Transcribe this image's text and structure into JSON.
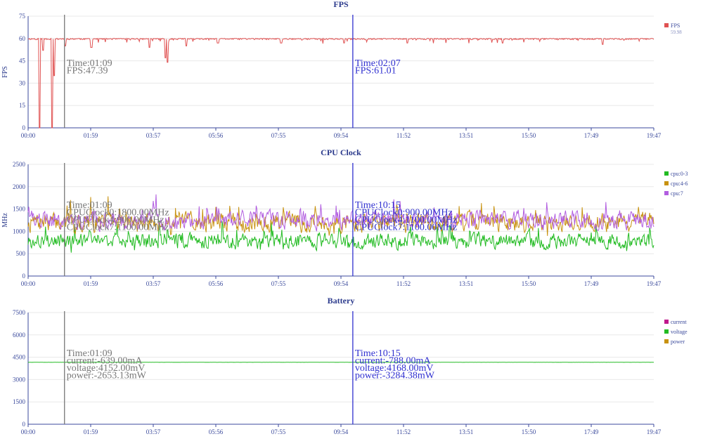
{
  "x_ticks": [
    "00:00",
    "01:59",
    "03:57",
    "05:56",
    "07:55",
    "09:54",
    "11:52",
    "13:51",
    "15:50",
    "17:49",
    "19:47"
  ],
  "x_range": [
    0,
    1187
  ],
  "charts": [
    {
      "type": "line",
      "title": "FPS",
      "ylabel": "FPS",
      "ylim": [
        0,
        75
      ],
      "yticks": [
        "0",
        "15",
        "30",
        "45",
        "60",
        "75"
      ],
      "legend": [
        {
          "name": "FPS",
          "value": "59.98",
          "color": "#e05252"
        }
      ],
      "series": [
        {
          "name": "FPS",
          "color": "#e05252",
          "baseline": 59.8,
          "noise": 1.2,
          "seed": 11,
          "dips": [
            [
              22,
              0
            ],
            [
              28,
              52
            ],
            [
              45,
              0
            ],
            [
              50,
              35
            ],
            [
              70,
              55
            ],
            [
              120,
              54
            ],
            [
              230,
              54
            ],
            [
              260,
              47
            ],
            [
              264,
              44
            ],
            [
              300,
              55
            ],
            [
              360,
              57
            ],
            [
              480,
              57
            ],
            [
              600,
              57
            ],
            [
              720,
              57
            ],
            [
              900,
              57
            ],
            [
              1090,
              56
            ]
          ]
        }
      ],
      "cursors": [
        {
          "x": 69,
          "color": "#777777",
          "lines": [
            "Time:01:09",
            "FPS:47.39"
          ]
        },
        {
          "x": 616,
          "color": "#3030d0",
          "lines": [
            "Time:02:07",
            "FPS:61.01"
          ]
        }
      ]
    },
    {
      "type": "line",
      "title": "CPU Clock",
      "ylabel": "MHz",
      "ylim": [
        0,
        2500
      ],
      "yticks": [
        "0",
        "500",
        "1000",
        "1500",
        "2000",
        "2500"
      ],
      "legend": [
        {
          "name": "cpu:0-3",
          "color": "#22bb22"
        },
        {
          "name": "cpu:4-6",
          "color": "#c89210"
        },
        {
          "name": "cpu:7",
          "color": "#b25ee0"
        }
      ],
      "series": [
        {
          "name": "cpu:0-3",
          "color": "#22bb22",
          "baseline": 780,
          "noise": 260,
          "seed": 3
        },
        {
          "name": "cpu:4-6",
          "color": "#c89210",
          "baseline": 1200,
          "noise": 320,
          "seed": 7
        },
        {
          "name": "cpu:7",
          "color": "#b25ee0",
          "baseline": 1250,
          "noise": 300,
          "seed": 19
        }
      ],
      "cursors": [
        {
          "x": 69,
          "color": "#777777",
          "lines": [
            "Time:01:09",
            "CPUClock0:1800.00MHz",
            "CPUClock4:900.00MHz",
            "CPUClock7:1100.00MHz"
          ]
        },
        {
          "x": 616,
          "color": "#3030d0",
          "lines": [
            "Time:10:15",
            "CPUClock0:900.00MHz",
            "CPUClock4:1100.00MHz",
            "CPUClock7:1100.00MHz"
          ]
        }
      ]
    },
    {
      "type": "line",
      "title": "Battery",
      "ylabel": "",
      "ylim": [
        0,
        7500
      ],
      "yticks": [
        "0",
        "1500",
        "3000",
        "4500",
        "6000",
        "7500"
      ],
      "legend": [
        {
          "name": "current",
          "color": "#c0188c"
        },
        {
          "name": "voltage",
          "color": "#22bb22"
        },
        {
          "name": "power",
          "color": "#c89210"
        }
      ],
      "series": [
        {
          "name": "voltage",
          "color": "#22bb22",
          "baseline": 4160,
          "noise": 8,
          "seed": 5
        }
      ],
      "cursors": [
        {
          "x": 69,
          "color": "#777777",
          "lines": [
            "Time:01:09",
            "current:-639.00mA",
            "voltage:4152.00mV",
            "power:-2653.13mW"
          ]
        },
        {
          "x": 616,
          "color": "#3030d0",
          "lines": [
            "Time:10:15",
            "current:-788.00mA",
            "voltage:4168.00mV",
            "power:-3284.38mW"
          ]
        }
      ]
    }
  ]
}
